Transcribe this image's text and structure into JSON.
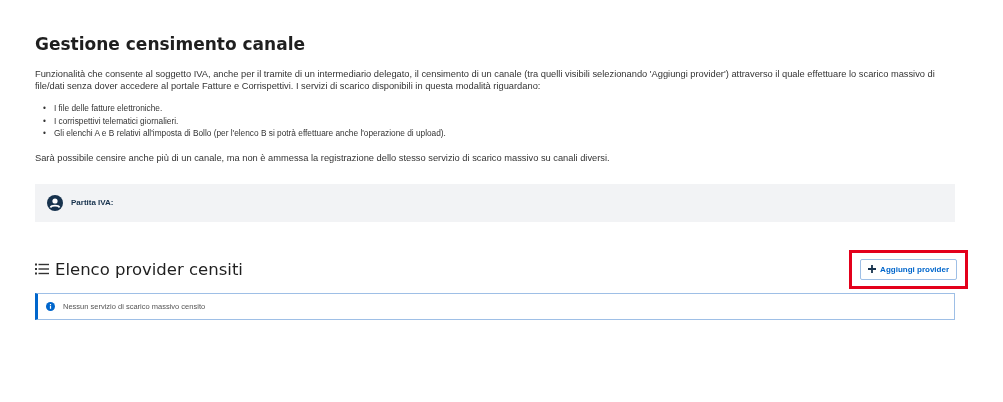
{
  "title": "Gestione censimento canale",
  "intro": "Funzionalità che consente al soggetto IVA, anche per il tramite di un intermediario delegato, il censimento di un canale (tra quelli visibili selezionando 'Aggiungi provider') attraverso il quale effettuare lo scarico massivo di file/dati senza dover accedere al portale Fatture e Corrispettivi. I servizi di scarico disponibili in questa modalità riguardano:",
  "services": [
    {
      "bullet": "•",
      "text": "I file delle fatture elettroniche."
    },
    {
      "bullet": "•",
      "text": "I corrispettivi telematici giornalieri."
    },
    {
      "bullet": "•",
      "text": "Gli elenchi A e B relativi all'imposta di Bollo (per l'elenco B si potrà effettuare anche l'operazione di upload)."
    }
  ],
  "note": "Sarà possibile censire anche più di un canale, ma non è ammessa la registrazione dello stesso servizio di scarico massivo su canali diversi.",
  "vat_panel": {
    "label": "Partita IVA:"
  },
  "section": {
    "heading": "Elenco provider censiti",
    "add_button": {
      "label": "Aggiungi provider",
      "highlighted": true
    }
  },
  "alert": {
    "message": "Nessun servizio di scarico massivo censito"
  }
}
